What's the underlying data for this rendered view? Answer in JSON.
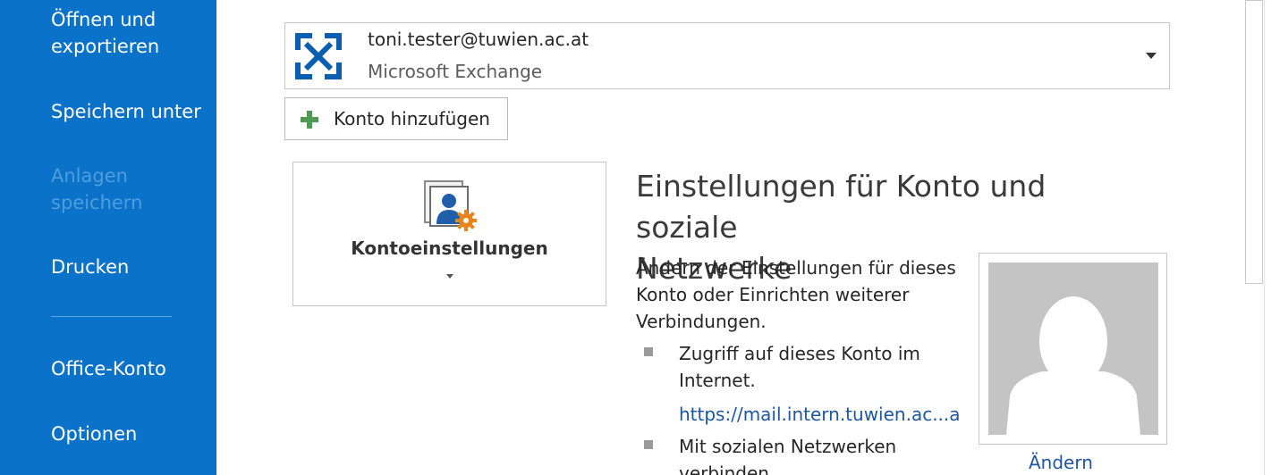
{
  "sidebar": {
    "items": [
      {
        "label": "Öffnen und"
      },
      {
        "label": "exportieren"
      },
      {
        "label": "Speichern unter"
      },
      {
        "label": "Anlagen"
      },
      {
        "label": "speichern"
      },
      {
        "label": "Drucken"
      },
      {
        "label": "Office-Konto"
      },
      {
        "label": "Optionen"
      }
    ],
    "accent_color": "#0a72c9"
  },
  "account": {
    "email": "toni.tester@tuwien.ac.at",
    "type": "Microsoft Exchange",
    "icon": "exchange-icon"
  },
  "add_account": {
    "label": "Konto hinzufügen",
    "icon": "plus-icon"
  },
  "account_settings": {
    "label": "Kontoeinstellungen",
    "icon": "account-settings-icon"
  },
  "section": {
    "heading_line1": "Einstellungen für Konto und soziale",
    "heading_line2": "Netzwerke",
    "desc_line1": "Ändern der Einstellungen für dieses",
    "desc_line2": "Konto oder Einrichten weiterer",
    "desc_line3": "Verbindungen.",
    "bullets": [
      {
        "line1": "Zugriff auf dieses Konto im",
        "line2": "Internet."
      },
      {
        "line1": "Mit sozialen Netzwerken",
        "line2": "verbinden."
      }
    ],
    "link": "https://mail.intern.tuwien.ac...a"
  },
  "photo": {
    "change_label": "Ändern",
    "icon": "default-avatar-icon"
  }
}
